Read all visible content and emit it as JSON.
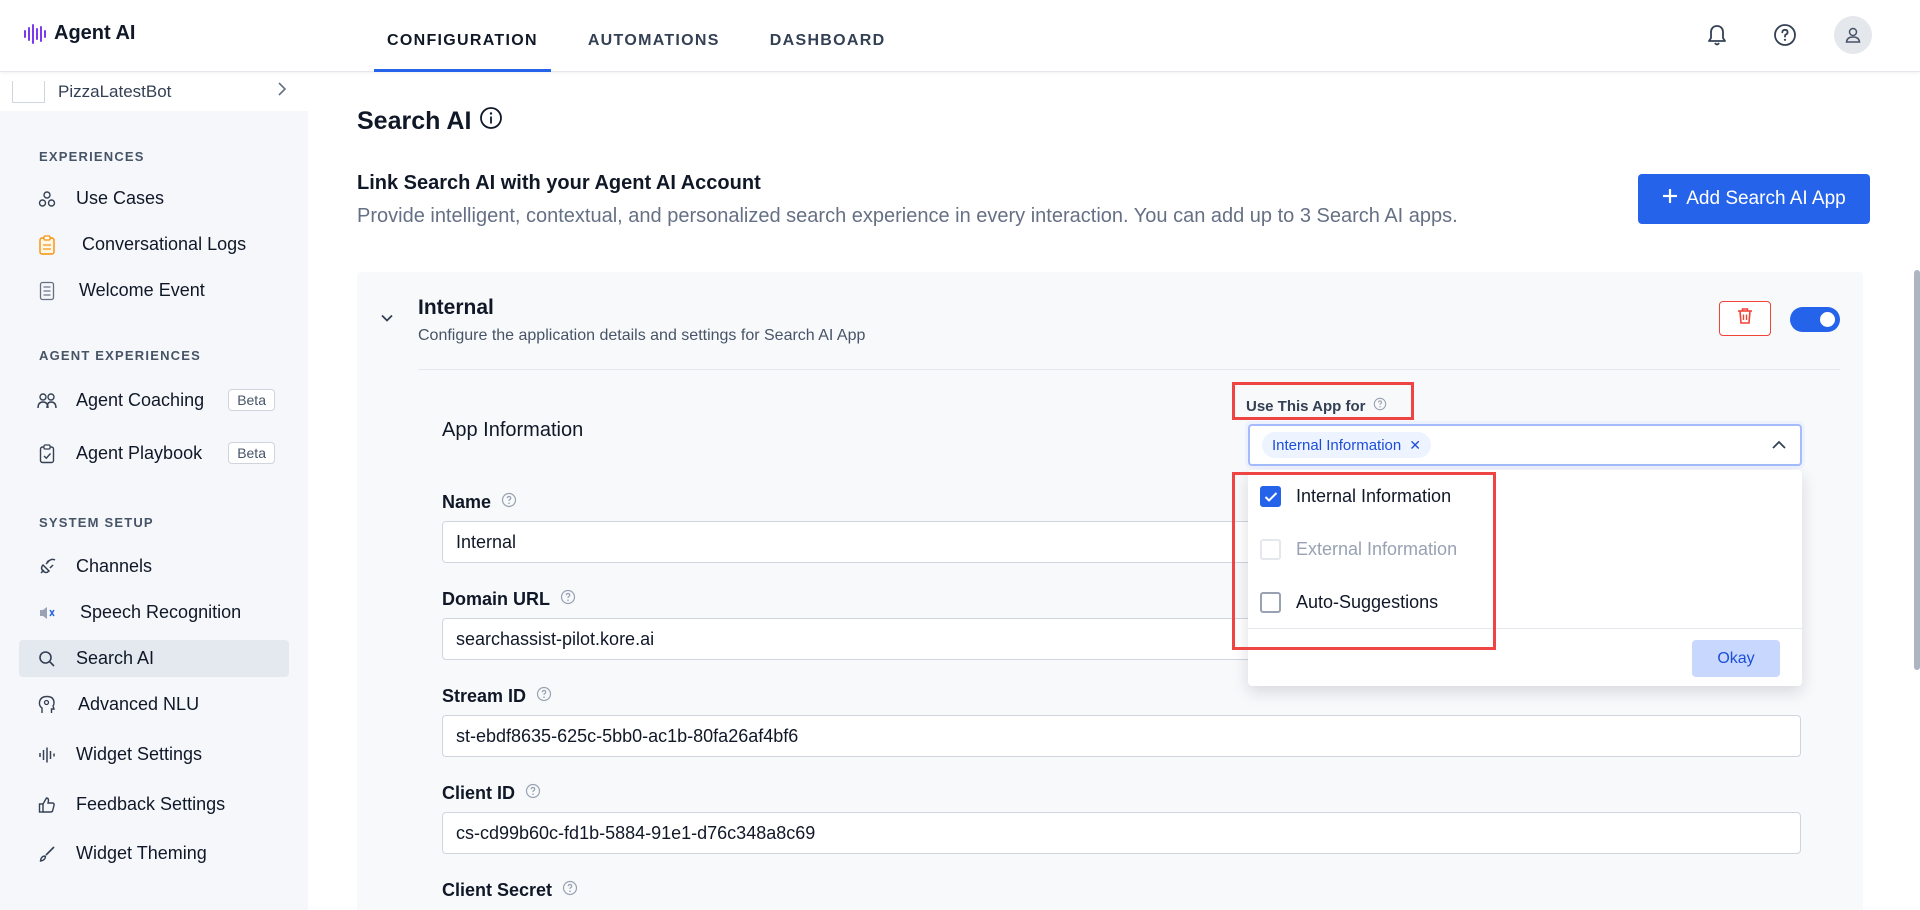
{
  "app": {
    "name": "Agent AI"
  },
  "nav": {
    "tabs": [
      {
        "label": "CONFIGURATION"
      },
      {
        "label": "AUTOMATIONS"
      },
      {
        "label": "DASHBOARD"
      }
    ]
  },
  "sidebar": {
    "bot_name": "PizzaLatestBot",
    "sections": [
      {
        "title": "EXPERIENCES"
      },
      {
        "title": "AGENT EXPERIENCES"
      },
      {
        "title": "SYSTEM SETUP"
      }
    ],
    "items": [
      {
        "label": "Use Cases",
        "icon": "use-cases-icon"
      },
      {
        "label": "Conversational Logs",
        "icon": "clipboard-icon"
      },
      {
        "label": "Welcome Event",
        "icon": "list-icon"
      },
      {
        "label": "Agent Coaching",
        "icon": "people-icon",
        "badge": "Beta"
      },
      {
        "label": "Agent Playbook",
        "icon": "playbook-icon",
        "badge": "Beta"
      },
      {
        "label": "Channels",
        "icon": "plug-icon"
      },
      {
        "label": "Speech Recognition",
        "icon": "speech-icon"
      },
      {
        "label": "Search AI",
        "icon": "search-icon",
        "active": true
      },
      {
        "label": "Advanced NLU",
        "icon": "brain-icon"
      },
      {
        "label": "Widget Settings",
        "icon": "waveform-icon"
      },
      {
        "label": "Feedback Settings",
        "icon": "thumbs-up-icon"
      },
      {
        "label": "Widget Theming",
        "icon": "brush-icon"
      }
    ]
  },
  "main": {
    "title": "Search AI",
    "link_title": "Link Search AI with your Agent AI Account",
    "link_desc": "Provide intelligent, contextual, and personalized search experience in every interaction. You can add up to 3 Search AI apps.",
    "add_button": "Add Search AI App",
    "card": {
      "title": "Internal",
      "subtitle": "Configure the application details and settings for Search AI App",
      "enabled": true,
      "section_title": "App Information",
      "fields": [
        {
          "label": "Name",
          "value": "Internal"
        },
        {
          "label": "Domain URL",
          "value": "searchassist-pilot.kore.ai"
        },
        {
          "label": "Stream ID",
          "value": "st-ebdf8635-625c-5bb0-ac1b-80fa26af4bf6"
        },
        {
          "label": "Client ID",
          "value": "cs-cd99b60c-fd1b-5884-91e1-d76c348a8c69"
        },
        {
          "label": "Client Secret",
          "value": ""
        }
      ],
      "use_for": {
        "label": "Use This App for",
        "selected_chip": "Internal Information",
        "options": [
          {
            "label": "Internal Information",
            "checked": true,
            "disabled": false
          },
          {
            "label": "External Information",
            "checked": false,
            "disabled": true
          },
          {
            "label": "Auto-Suggestions",
            "checked": false,
            "disabled": false
          }
        ],
        "okay_label": "Okay"
      }
    }
  },
  "colors": {
    "accent": "#2563eb",
    "highlight": "#ef4444",
    "danger": "#f04438"
  }
}
